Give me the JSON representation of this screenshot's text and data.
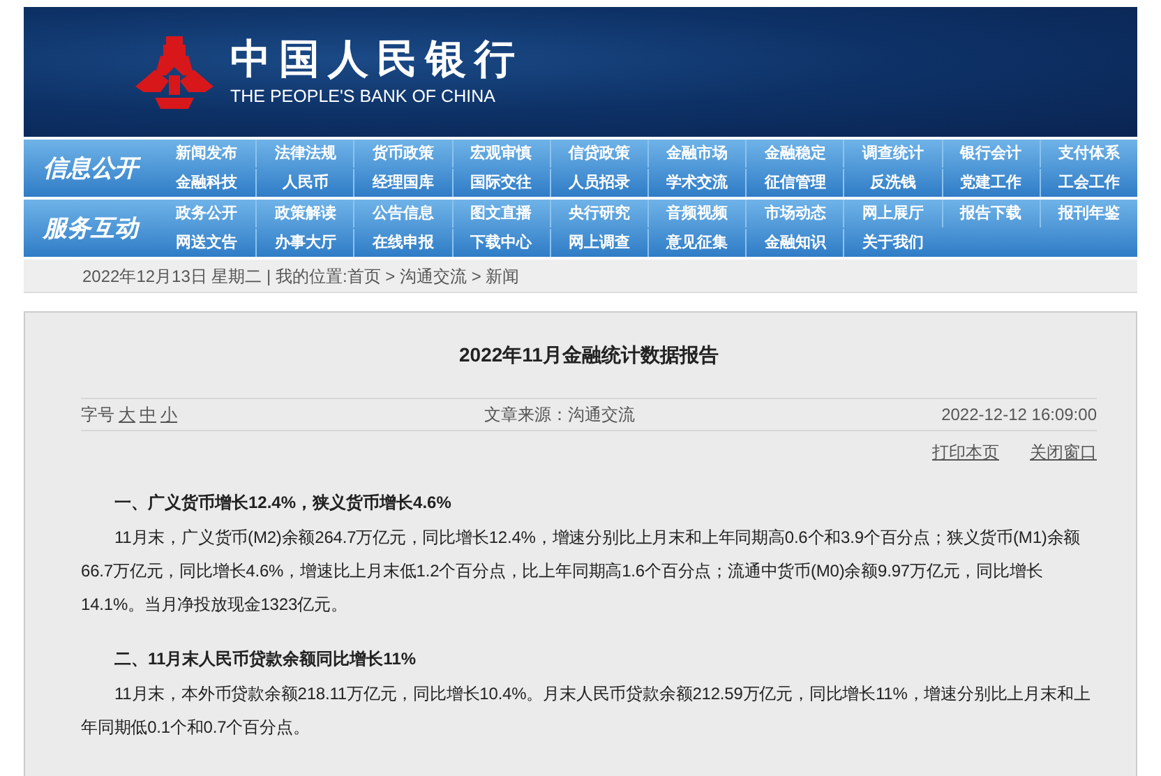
{
  "header": {
    "title_cn": "中国人民银行",
    "title_en": "THE PEOPLE'S BANK OF CHINA"
  },
  "nav_groups": [
    {
      "label": "信息公开",
      "rows": [
        [
          "新闻发布",
          "法律法规",
          "货币政策",
          "宏观审慎",
          "信贷政策",
          "金融市场",
          "金融稳定",
          "调查统计",
          "银行会计",
          "支付体系"
        ],
        [
          "金融科技",
          "人民币",
          "经理国库",
          "国际交往",
          "人员招录",
          "学术交流",
          "征信管理",
          "反洗钱",
          "党建工作",
          "工会工作"
        ]
      ]
    },
    {
      "label": "服务互动",
      "rows": [
        [
          "政务公开",
          "政策解读",
          "公告信息",
          "图文直播",
          "央行研究",
          "音频视频",
          "市场动态",
          "网上展厅",
          "报告下载",
          "报刊年鉴"
        ],
        [
          "网送文告",
          "办事大厅",
          "在线申报",
          "下载中心",
          "网上调查",
          "意见征集",
          "金融知识",
          "关于我们"
        ]
      ]
    }
  ],
  "breadcrumb": "2022年12月13日 星期二 | 我的位置:首页 > 沟通交流 > 新闻",
  "article": {
    "title": "2022年11月金融统计数据报告",
    "font_size_label": "字号",
    "font_sizes": [
      "大",
      "中",
      "小"
    ],
    "source": "文章来源：沟通交流",
    "date": "2022-12-12 16:09:00",
    "actions": [
      "打印本页",
      "关闭窗口"
    ],
    "sections": [
      {
        "kind": "heading",
        "text": "一、广义货币增长12.4%，狭义货币增长4.6%"
      },
      {
        "kind": "paragraph",
        "text": "11月末，广义货币(M2)余额264.7万亿元，同比增长12.4%，增速分别比上月末和上年同期高0.6个和3.9个百分点；狭义货币(M1)余额66.7万亿元，同比增长4.6%，增速比上月末低1.2个百分点，比上年同期高1.6个百分点；流通中货币(M0)余额9.97万亿元，同比增长14.1%。当月净投放现金1323亿元。"
      },
      {
        "kind": "heading",
        "text": "二、11月末人民币贷款余额同比增长11%"
      },
      {
        "kind": "paragraph",
        "text": "11月末，本外币贷款余额218.11万亿元，同比增长10.4%。月末人民币贷款余额212.59万亿元，同比增长11%，增速分别比上月末和上年同期低0.1个和0.7个百分点。"
      }
    ]
  }
}
